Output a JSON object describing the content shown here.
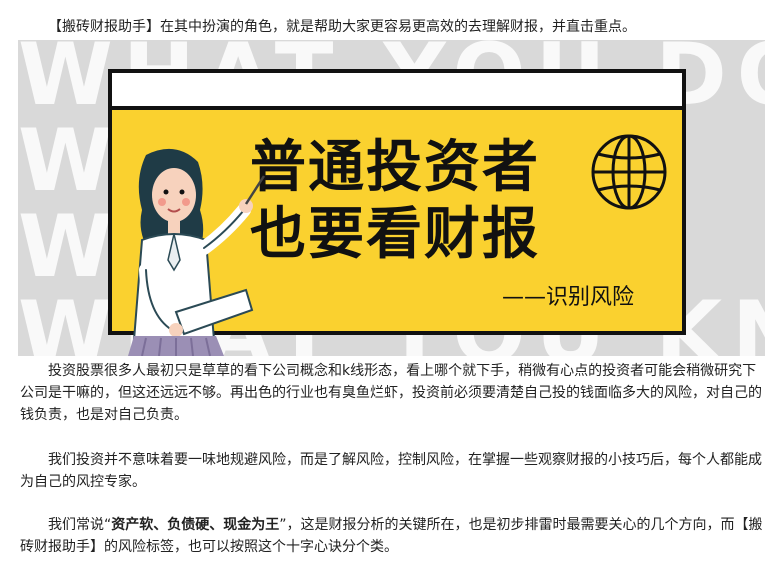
{
  "intro": "【搬砖财报助手】在其中扮演的角色，就是帮助大家更容易更高效的去理解财报，并直击重点。",
  "banner": {
    "background_rows": [
      "WHAT YOU DON'T",
      "W           W",
      "W           T",
      "WHAT YOU KNOW"
    ],
    "headline_line1": "普通投资者",
    "headline_line2": "也要看财报",
    "tagline": "——识别风险",
    "colors": {
      "card": "#fad12f",
      "background": "#d9d9d9",
      "ink": "#111111"
    }
  },
  "paragraphs": {
    "p1": "投资股票很多人最初只是草草的看下公司概念和k线形态，看上哪个就下手，稍微有心点的投资者可能会稍微研究下公司是干嘛的，但这还远远不够。再出色的行业也有臭鱼烂虾，投资前必须要清楚自己投的钱面临多大的风险，对自己的钱负责，也是对自己负责。",
    "p2": "我们投资并不意味着要一味地规避风险，而是了解风险，控制风险，在掌握一些观察财报的小技巧后，每个人都能成为自己的风控专家。",
    "p3_before": "我们常说“",
    "p3_bold": "资产软、负债硬、现金为王",
    "p3_after": "”，这是财报分析的关键所在，也是初步排雷时最需要关心的几个方向，而【搬砖财报助手】的风险标签，也可以按照这个十字心诀分个类。"
  }
}
